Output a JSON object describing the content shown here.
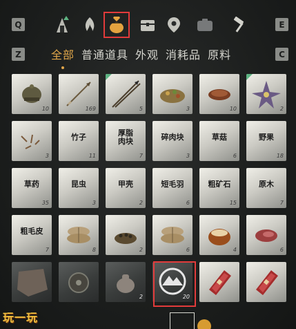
{
  "keys": {
    "left_top": "Q",
    "right_top": "E",
    "left_tabs": "Z",
    "right_tabs": "C"
  },
  "categories": [
    {
      "name": "tent-campfire-icon",
      "selected": false
    },
    {
      "name": "fire-bundle-icon",
      "selected": false
    },
    {
      "name": "money-pouch-icon",
      "selected": true
    },
    {
      "name": "chest-icon",
      "selected": false
    },
    {
      "name": "location-pin-icon",
      "selected": false
    },
    {
      "name": "bag-icon",
      "selected": false
    },
    {
      "name": "hammer-icon",
      "selected": false
    }
  ],
  "tabs": [
    "全部",
    "普通道具",
    "外观",
    "消耗品",
    "原料"
  ],
  "active_tab": 0,
  "items": [
    {
      "label": "",
      "count": "10",
      "icon": "bronze-helmet-icon"
    },
    {
      "label": "",
      "count": "169",
      "icon": "arrow-icon"
    },
    {
      "label": "",
      "count": "5",
      "icon": "spear-icon"
    },
    {
      "label": "",
      "count": "3",
      "icon": "mixed-food-bowl-icon"
    },
    {
      "label": "",
      "count": "10",
      "icon": "dried-meat-icon"
    },
    {
      "label": "",
      "count": "2",
      "icon": "purple-flower-icon"
    },
    {
      "label": "",
      "count": "3",
      "icon": "sprigs-icon"
    },
    {
      "label": "竹子",
      "count": "11",
      "icon": ""
    },
    {
      "label": "厚脂肉块",
      "count": "7",
      "icon": ""
    },
    {
      "label": "碎肉块",
      "count": "3",
      "icon": ""
    },
    {
      "label": "草菇",
      "count": "6",
      "icon": ""
    },
    {
      "label": "野果",
      "count": "18",
      "icon": ""
    },
    {
      "label": "草药",
      "count": "35",
      "icon": ""
    },
    {
      "label": "昆虫",
      "count": "3",
      "icon": ""
    },
    {
      "label": "甲壳",
      "count": "2",
      "icon": ""
    },
    {
      "label": "短毛羽",
      "count": "6",
      "icon": ""
    },
    {
      "label": "粗矿石",
      "count": "15",
      "icon": ""
    },
    {
      "label": "原木",
      "count": "7",
      "icon": ""
    },
    {
      "label": "粗毛皮",
      "count": "7",
      "icon": ""
    },
    {
      "label": "",
      "count": "8",
      "icon": "grain-sacks-icon"
    },
    {
      "label": "",
      "count": "2",
      "icon": "bean-bowl-icon"
    },
    {
      "label": "",
      "count": "6",
      "icon": "grain-sacks-icon"
    },
    {
      "label": "",
      "count": "4",
      "icon": "chestnut-icon"
    },
    {
      "label": "",
      "count": "6",
      "icon": "raw-meat-icon"
    },
    {
      "label": "",
      "count": "",
      "icon": "fur-pelt-icon"
    },
    {
      "label": "",
      "count": "",
      "icon": "round-shield-icon"
    },
    {
      "label": "",
      "count": "2",
      "icon": "cloth-pouch-icon"
    },
    {
      "label": "",
      "count": "20",
      "icon": "mountain-emblem-icon"
    },
    {
      "label": "",
      "count": "",
      "icon": "red-box-icon"
    },
    {
      "label": "",
      "count": "",
      "icon": "red-box-icon"
    }
  ],
  "watermark": "玩一玩"
}
